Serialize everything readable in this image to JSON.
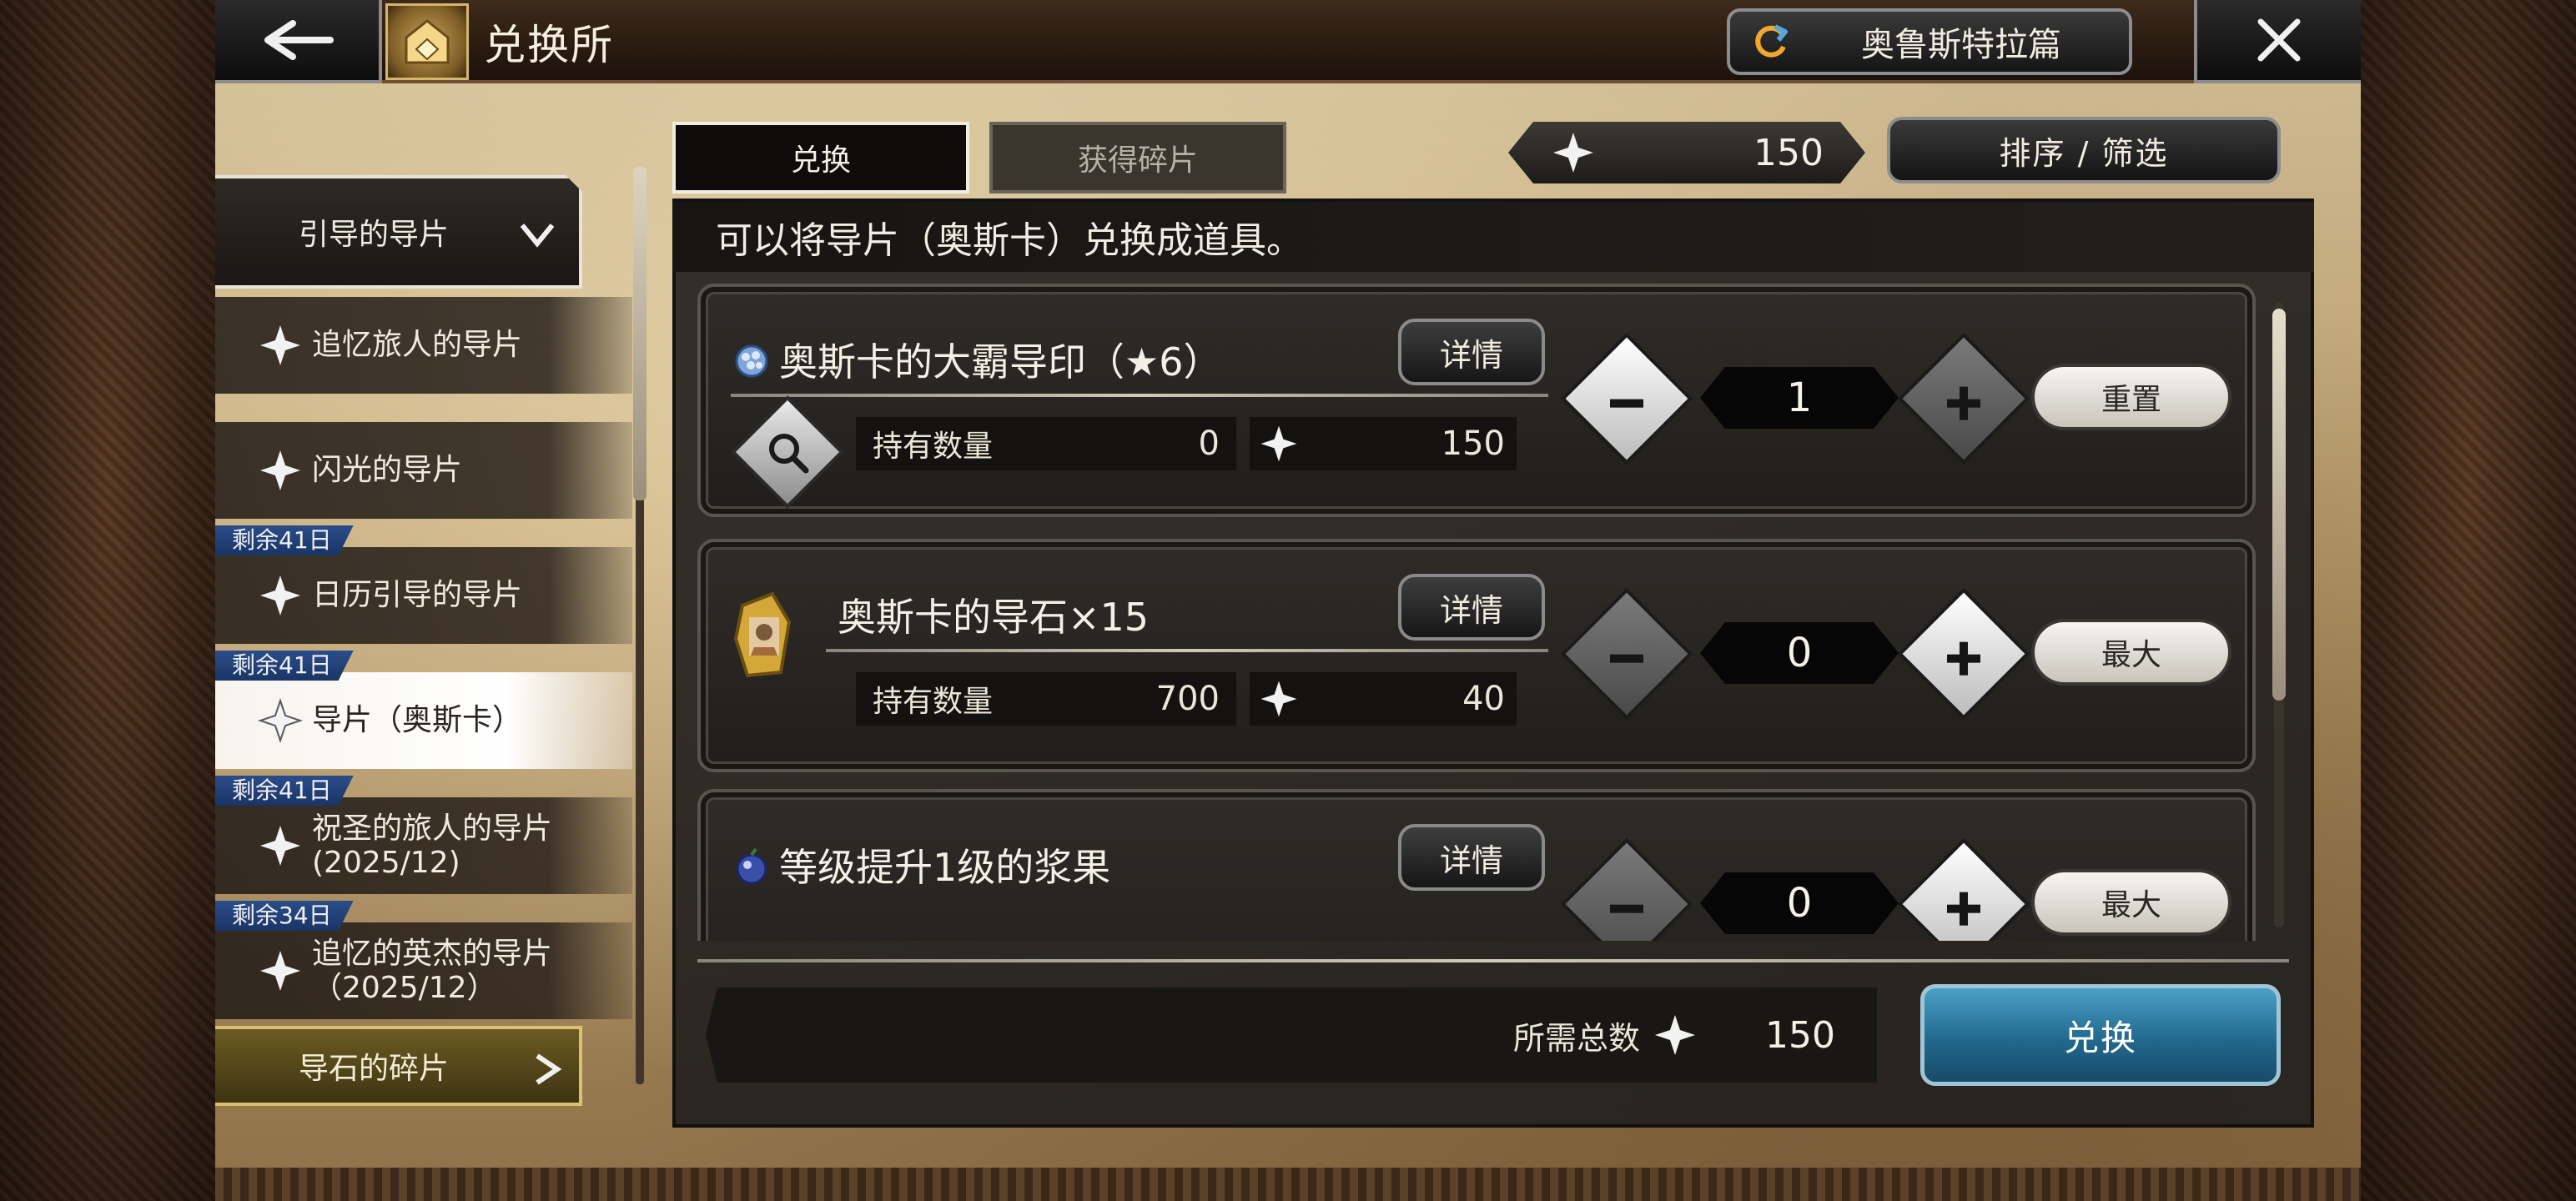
{
  "header": {
    "title": "兑换所",
    "chapter_label": "奥鲁斯特拉篇"
  },
  "tabs": [
    {
      "label": "兑换",
      "active": true
    },
    {
      "label": "获得碎片",
      "active": false
    }
  ],
  "currency": {
    "amount": "150"
  },
  "sort_label": "排序 / 筛选",
  "sidebar": {
    "category_header": "引导的导片",
    "items": [
      {
        "label": "追忆旅人的导片",
        "badge": ""
      },
      {
        "label": "闪光的导片",
        "badge": ""
      },
      {
        "label": "日历引导的导片",
        "badge": "剩余41日"
      },
      {
        "label": "导片（奥斯卡）",
        "badge": "剩余41日",
        "active": true
      },
      {
        "label": "祝圣的旅人的导片\n(2025/12)",
        "badge": "剩余41日"
      },
      {
        "label": "追忆的英杰的导片\n（2025/12）",
        "badge": "剩余34日"
      }
    ],
    "category_footer": "导石的碎片"
  },
  "panel": {
    "description": "可以将导片（奥斯卡）兑换成道具。",
    "detail_label": "详情",
    "held_label": "持有数量",
    "items": [
      {
        "name": "奥斯卡的大霸导印（★6）",
        "held": "0",
        "cost": "150",
        "quantity": "1",
        "side_button": "重置"
      },
      {
        "name": "奥斯卡的导石×15",
        "held": "700",
        "cost": "40",
        "quantity": "0",
        "side_button": "最大"
      },
      {
        "name": "等级提升1级的浆果",
        "held": "",
        "cost": "",
        "quantity": "0",
        "side_button": "最大"
      }
    ]
  },
  "footer": {
    "total_label": "所需总数",
    "total_value": "150",
    "exchange_label": "兑换"
  },
  "colors": {
    "exchange_button": "#22698e",
    "badge": "#1f3f78",
    "footer_category": "#6b5a22"
  }
}
